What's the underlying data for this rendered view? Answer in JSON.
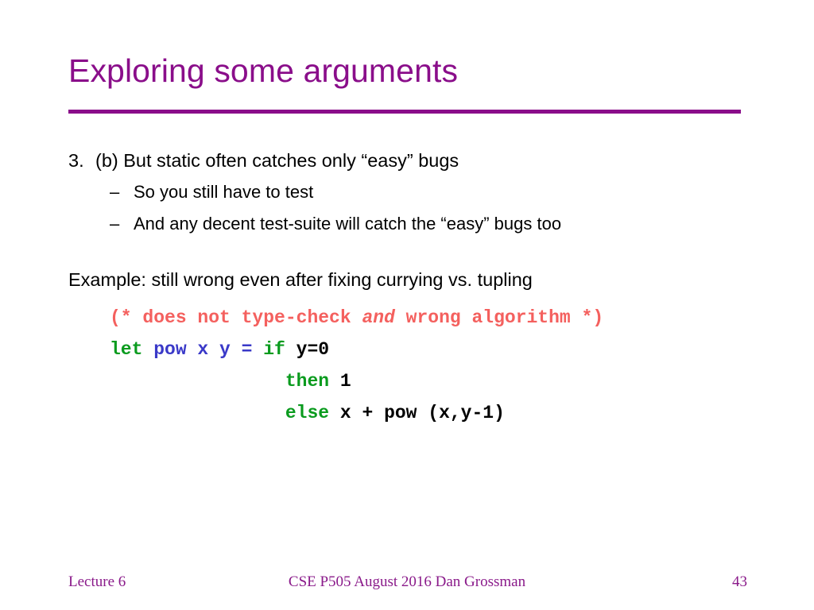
{
  "slide": {
    "title": "Exploring some arguments",
    "accent_color": "#8A0E8A",
    "background_color": "#ffffff",
    "bullets": {
      "item3_marker": "3.",
      "item3_text": "(b) But static often catches only “easy” bugs",
      "sub1_marker": "–",
      "sub1_text": "So you still have to test",
      "sub2_marker": "–",
      "sub2_text": "And any decent test-suite will catch the “easy” bugs too"
    },
    "example_line": "Example: still wrong even after fixing currying vs. tupling",
    "code": {
      "comment_pre": "(* does not type-check ",
      "comment_em": "and",
      "comment_post": " wrong algorithm *)",
      "line1_kw": "let ",
      "line1_fn": "pow x y = ",
      "line1_kw2": "if ",
      "line1_rest": "y=0",
      "line2_indent": "                ",
      "line2_kw": "then ",
      "line2_rest": "1",
      "line3_indent": "                ",
      "line3_kw": "else ",
      "line3_rest": "x + pow (x,y-1)",
      "colors": {
        "keyword": "#0A9B1E",
        "function": "#3A39C8",
        "comment": "#F4605E",
        "default": "#000000"
      }
    },
    "footer": {
      "left": "Lecture 6",
      "center": "CSE P505 August 2016  Dan Grossman",
      "right": "43",
      "color": "#8A1A8A"
    }
  }
}
